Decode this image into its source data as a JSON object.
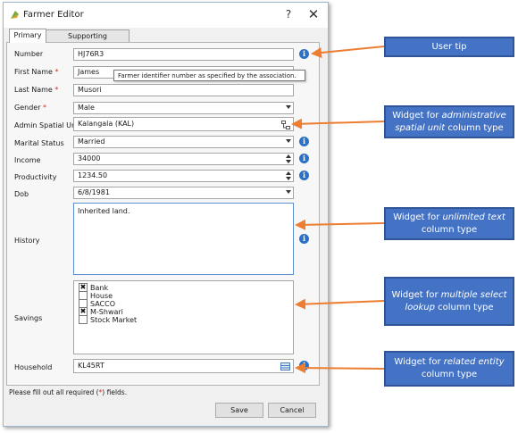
{
  "window": {
    "title": "Farmer Editor",
    "help_label": "?",
    "close_label": "✕"
  },
  "tabs": [
    "Primary",
    "Supporting Documents"
  ],
  "fields": {
    "number": {
      "label": "Number",
      "value": "HJ76R3"
    },
    "first_name": {
      "label": "First Name",
      "required_mark": "*",
      "value": "James"
    },
    "last_name": {
      "label": "Last Name",
      "required_mark": "*",
      "value": "Musori"
    },
    "gender": {
      "label": "Gender",
      "required_mark": "*",
      "value": "Male"
    },
    "admin_spatial_unit": {
      "label": "Admin Spatial Unit",
      "value": "Kalangala (KAL)"
    },
    "marital_status": {
      "label": "Marital Status",
      "value": "Married"
    },
    "income": {
      "label": "Income",
      "value": "34000"
    },
    "productivity": {
      "label": "Productivity",
      "value": "1234.50"
    },
    "dob": {
      "label": "Dob",
      "value": "6/8/1981"
    },
    "history": {
      "label": "History",
      "value": "Inherited land."
    },
    "savings": {
      "label": "Savings",
      "options": [
        {
          "label": "Bank",
          "checked": true
        },
        {
          "label": "House",
          "checked": false
        },
        {
          "label": "SACCO",
          "checked": false
        },
        {
          "label": "M-Shwari",
          "checked": true
        },
        {
          "label": "Stock Market",
          "checked": false
        }
      ]
    },
    "household": {
      "label": "Household",
      "value": "KL45RT"
    }
  },
  "tooltip": "Farmer identifier number as specified by the association.",
  "footer": {
    "note_before": "Please fill out all required (",
    "note_mark": "*",
    "note_after": ") fields."
  },
  "buttons": {
    "save": "Save",
    "cancel": "Cancel"
  },
  "callouts": {
    "user_tip": "User tip",
    "admin": {
      "prefix": "Widget for ",
      "italic": "administrative spatial unit",
      "suffix": " column type"
    },
    "text": {
      "prefix": "Widget for ",
      "italic": "unlimited text",
      "suffix": " column type"
    },
    "lookup": {
      "prefix": "Widget for ",
      "italic": "multiple select lookup",
      "suffix": " column type"
    },
    "entity": {
      "prefix": "Widget for ",
      "italic": "related entity",
      "suffix": " column type"
    }
  },
  "colors": {
    "callout_bg": "#4472c4",
    "arrow": "#ed7d31",
    "info_icon": "#2b71c6",
    "required": "#d52b1e"
  }
}
